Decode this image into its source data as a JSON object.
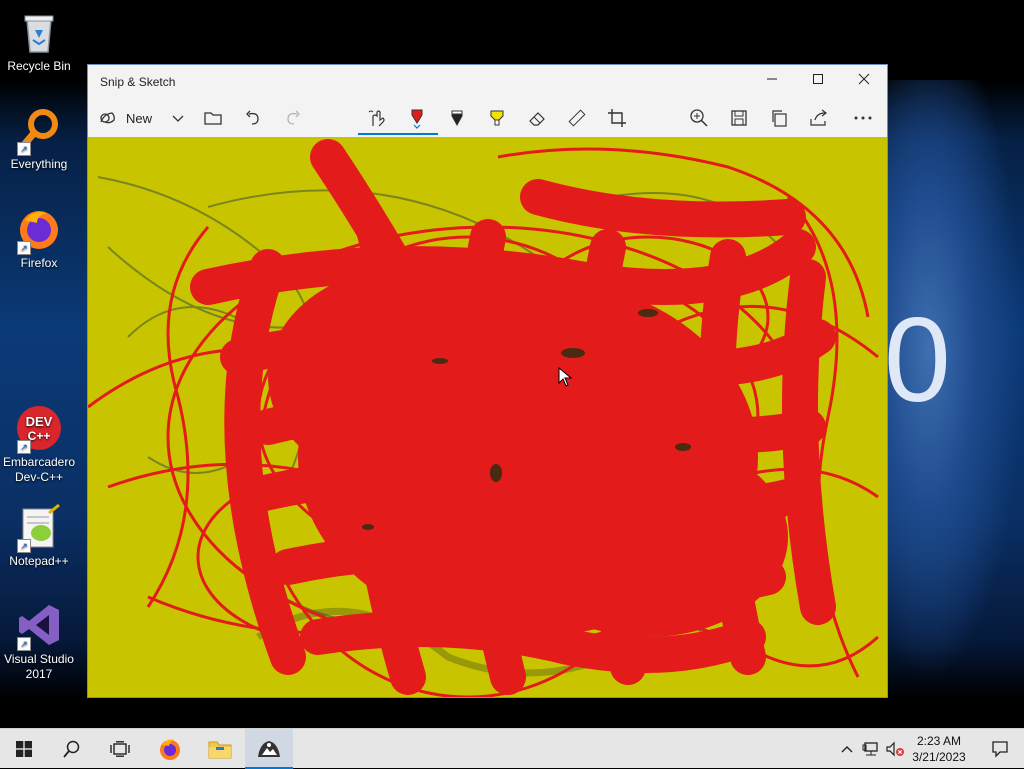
{
  "desktop": {
    "wallpaper_text": "0",
    "icons": [
      {
        "label": "Recycle Bin",
        "icon": "recycle-bin-icon"
      },
      {
        "label": "Everything",
        "icon": "everything-search-icon"
      },
      {
        "label": "Firefox",
        "icon": "firefox-icon"
      },
      {
        "label": "Embarcadero Dev-C++",
        "icon": "devcpp-icon",
        "badge": "DEV C++"
      },
      {
        "label": "Notepad++",
        "icon": "notepadpp-icon"
      },
      {
        "label": "Visual Studio 2017",
        "icon": "visual-studio-icon"
      }
    ]
  },
  "window": {
    "title": "Snip & Sketch",
    "toolbar": {
      "new_label": "New",
      "tools": [
        "touch-writing-icon",
        "ballpoint-pen-icon",
        "pencil-icon",
        "highlighter-icon",
        "eraser-icon",
        "ruler-icon",
        "crop-icon"
      ],
      "actions": [
        "zoom-icon",
        "save-icon",
        "copy-icon",
        "share-icon",
        "more-icon"
      ]
    },
    "canvas": {
      "background": "#c9c400",
      "ink_color": "#e31b1b",
      "pencil_color": "#5a6b2a"
    }
  },
  "taskbar": {
    "time": "2:23 AM",
    "date": "3/21/2023",
    "items": [
      "start-icon",
      "search-icon",
      "task-view-icon",
      "firefox-icon",
      "file-explorer-icon",
      "snip-sketch-icon"
    ]
  },
  "colors": {
    "accent": "#0078d4",
    "ink_red": "#e31b1b",
    "canvas_yellow": "#c9c400"
  }
}
